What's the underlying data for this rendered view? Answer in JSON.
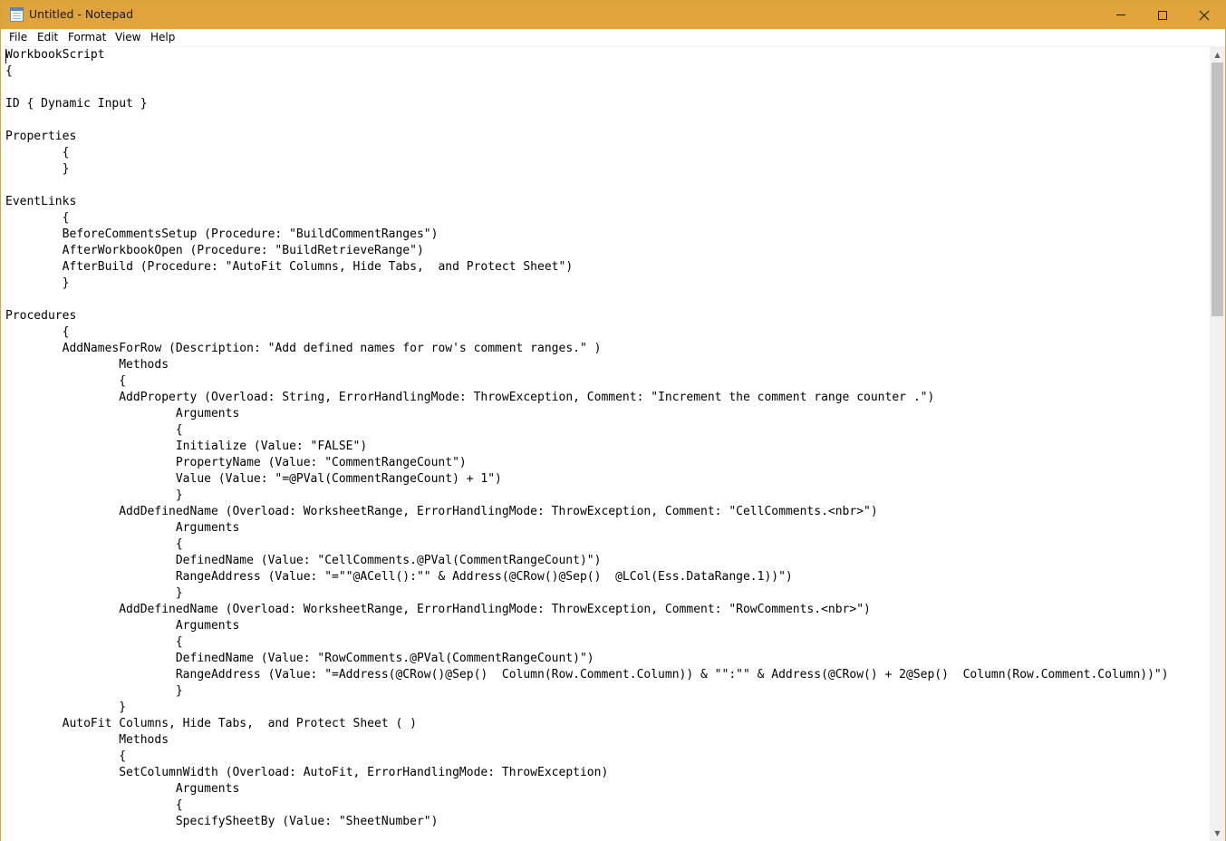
{
  "window": {
    "title": "Untitled - Notepad",
    "title_bar_color": "#dfa43b",
    "app_icon": "notepad-icon"
  },
  "controls": {
    "minimize_icon": "minimize-icon",
    "maximize_icon": "maximize-icon",
    "close_icon": "close-icon",
    "close_glyph": "✕"
  },
  "menu": {
    "file": "File",
    "edit": "Edit",
    "format": "Format",
    "view": "View",
    "help": "Help"
  },
  "editor": {
    "content": "WorkbookScript\n{\n\nID { Dynamic Input }\n\nProperties\n\t{\n\t}\n\nEventLinks\n\t{\n\tBeforeCommentsSetup (Procedure: \"BuildCommentRanges\")\n\tAfterWorkbookOpen (Procedure: \"BuildRetrieveRange\")\n\tAfterBuild (Procedure: \"AutoFit Columns, Hide Tabs,  and Protect Sheet\")\n\t}\n\nProcedures\n\t{\n\tAddNamesForRow (Description: \"Add defined names for row's comment ranges.\" )\n\t\tMethods\n\t\t{\n\t\tAddProperty (Overload: String, ErrorHandlingMode: ThrowException, Comment: \"Increment the comment range counter .\")\n\t\t\tArguments\n\t\t\t{\n\t\t\tInitialize (Value: \"FALSE\")\n\t\t\tPropertyName (Value: \"CommentRangeCount\")\n\t\t\tValue (Value: \"=@PVal(CommentRangeCount) + 1\")\n\t\t\t}\n\t\tAddDefinedName (Overload: WorksheetRange, ErrorHandlingMode: ThrowException, Comment: \"CellComments.<nbr>\")\n\t\t\tArguments\n\t\t\t{\n\t\t\tDefinedName (Value: \"CellComments.@PVal(CommentRangeCount)\")\n\t\t\tRangeAddress (Value: \"=\"\"@ACell():\"\" & Address(@CRow()@Sep()  @LCol(Ess.DataRange.1))\")\n\t\t\t}\n\t\tAddDefinedName (Overload: WorksheetRange, ErrorHandlingMode: ThrowException, Comment: \"RowComments.<nbr>\")\n\t\t\tArguments\n\t\t\t{\n\t\t\tDefinedName (Value: \"RowComments.@PVal(CommentRangeCount)\")\n\t\t\tRangeAddress (Value: \"=Address(@CRow()@Sep()  Column(Row.Comment.Column)) & \"\":\"\" & Address(@CRow() + 2@Sep()  Column(Row.Comment.Column))\")\n\t\t\t}\n\t\t}\n\tAutoFit Columns, Hide Tabs,  and Protect Sheet ( )\n\t\tMethods\n\t\t{\n\t\tSetColumnWidth (Overload: AutoFit, ErrorHandlingMode: ThrowException)\n\t\t\tArguments\n\t\t\t{\n\t\t\tSpecifySheetBy (Value: \"SheetNumber\")"
  },
  "scrollbar": {
    "up_arrow": "▲",
    "down_arrow": "▼",
    "up_icon": "scroll-up-arrow-icon",
    "down_icon": "scroll-down-arrow-icon"
  }
}
